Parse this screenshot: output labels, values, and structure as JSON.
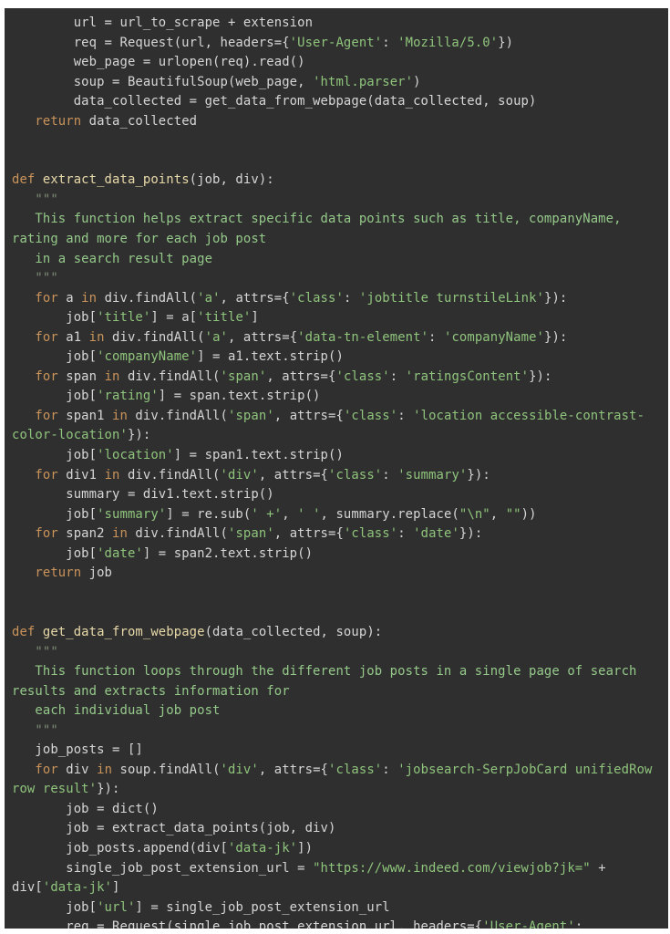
{
  "editor": {
    "language": "python",
    "lines": [
      [
        {
          "t": "        url = url_to_scrape + extension",
          "c": "pl"
        }
      ],
      [
        {
          "t": "        req = Request(url, headers={",
          "c": "pl"
        },
        {
          "t": "'User-Agent'",
          "c": "str"
        },
        {
          "t": ": ",
          "c": "pl"
        },
        {
          "t": "'Mozilla/5.0'",
          "c": "str"
        },
        {
          "t": "})",
          "c": "pl"
        }
      ],
      [
        {
          "t": "        web_page = urlopen(req).read()",
          "c": "pl"
        }
      ],
      [
        {
          "t": "        soup = BeautifulSoup(web_page, ",
          "c": "pl"
        },
        {
          "t": "'html.parser'",
          "c": "str"
        },
        {
          "t": ")",
          "c": "pl"
        }
      ],
      [
        {
          "t": "        data_collected = get_data_from_webpage(data_collected, soup)",
          "c": "pl"
        }
      ],
      [
        {
          "t": "   ",
          "c": "pl"
        },
        {
          "t": "return",
          "c": "kw"
        },
        {
          "t": " data_collected",
          "c": "pl"
        }
      ],
      [],
      [],
      [
        {
          "t": "def",
          "c": "kw"
        },
        {
          "t": " ",
          "c": "pl"
        },
        {
          "t": "extract_data_points",
          "c": "fn"
        },
        {
          "t": "(job, div):",
          "c": "pl"
        }
      ],
      [
        {
          "t": "   \"\"\"",
          "c": "dq"
        }
      ],
      [
        {
          "t": "   This function helps extract specific data points such as title, companyName,",
          "c": "doc"
        }
      ],
      [
        {
          "t": "rating and more for each job post",
          "c": "doc"
        }
      ],
      [
        {
          "t": "   in a search result page",
          "c": "doc"
        }
      ],
      [
        {
          "t": "   \"\"\"",
          "c": "dq"
        }
      ],
      [
        {
          "t": "   ",
          "c": "pl"
        },
        {
          "t": "for",
          "c": "kw"
        },
        {
          "t": " a ",
          "c": "pl"
        },
        {
          "t": "in",
          "c": "kw"
        },
        {
          "t": " div.findAll(",
          "c": "pl"
        },
        {
          "t": "'a'",
          "c": "str"
        },
        {
          "t": ", attrs={",
          "c": "pl"
        },
        {
          "t": "'class'",
          "c": "str"
        },
        {
          "t": ": ",
          "c": "pl"
        },
        {
          "t": "'jobtitle turnstileLink'",
          "c": "str"
        },
        {
          "t": "}):",
          "c": "pl"
        }
      ],
      [
        {
          "t": "       job[",
          "c": "pl"
        },
        {
          "t": "'title'",
          "c": "str"
        },
        {
          "t": "] = a[",
          "c": "pl"
        },
        {
          "t": "'title'",
          "c": "str"
        },
        {
          "t": "]",
          "c": "pl"
        }
      ],
      [
        {
          "t": "   ",
          "c": "pl"
        },
        {
          "t": "for",
          "c": "kw"
        },
        {
          "t": " a1 ",
          "c": "pl"
        },
        {
          "t": "in",
          "c": "kw"
        },
        {
          "t": " div.findAll(",
          "c": "pl"
        },
        {
          "t": "'a'",
          "c": "str"
        },
        {
          "t": ", attrs={",
          "c": "pl"
        },
        {
          "t": "'data-tn-element'",
          "c": "str"
        },
        {
          "t": ": ",
          "c": "pl"
        },
        {
          "t": "'companyName'",
          "c": "str"
        },
        {
          "t": "}):",
          "c": "pl"
        }
      ],
      [
        {
          "t": "       job[",
          "c": "pl"
        },
        {
          "t": "'companyName'",
          "c": "str"
        },
        {
          "t": "] = a1.text.strip()",
          "c": "pl"
        }
      ],
      [
        {
          "t": "   ",
          "c": "pl"
        },
        {
          "t": "for",
          "c": "kw"
        },
        {
          "t": " span ",
          "c": "pl"
        },
        {
          "t": "in",
          "c": "kw"
        },
        {
          "t": " div.findAll(",
          "c": "pl"
        },
        {
          "t": "'span'",
          "c": "str"
        },
        {
          "t": ", attrs={",
          "c": "pl"
        },
        {
          "t": "'class'",
          "c": "str"
        },
        {
          "t": ": ",
          "c": "pl"
        },
        {
          "t": "'ratingsContent'",
          "c": "str"
        },
        {
          "t": "}):",
          "c": "pl"
        }
      ],
      [
        {
          "t": "       job[",
          "c": "pl"
        },
        {
          "t": "'rating'",
          "c": "str"
        },
        {
          "t": "] = span.text.strip()",
          "c": "pl"
        }
      ],
      [
        {
          "t": "   ",
          "c": "pl"
        },
        {
          "t": "for",
          "c": "kw"
        },
        {
          "t": " span1 ",
          "c": "pl"
        },
        {
          "t": "in",
          "c": "kw"
        },
        {
          "t": " div.findAll(",
          "c": "pl"
        },
        {
          "t": "'span'",
          "c": "str"
        },
        {
          "t": ", attrs={",
          "c": "pl"
        },
        {
          "t": "'class'",
          "c": "str"
        },
        {
          "t": ": ",
          "c": "pl"
        },
        {
          "t": "'location accessible-contrast-",
          "c": "str"
        }
      ],
      [
        {
          "t": "color-location'",
          "c": "str"
        },
        {
          "t": "}):",
          "c": "pl"
        }
      ],
      [
        {
          "t": "       job[",
          "c": "pl"
        },
        {
          "t": "'location'",
          "c": "str"
        },
        {
          "t": "] = span1.text.strip()",
          "c": "pl"
        }
      ],
      [
        {
          "t": "   ",
          "c": "pl"
        },
        {
          "t": "for",
          "c": "kw"
        },
        {
          "t": " div1 ",
          "c": "pl"
        },
        {
          "t": "in",
          "c": "kw"
        },
        {
          "t": " div.findAll(",
          "c": "pl"
        },
        {
          "t": "'div'",
          "c": "str"
        },
        {
          "t": ", attrs={",
          "c": "pl"
        },
        {
          "t": "'class'",
          "c": "str"
        },
        {
          "t": ": ",
          "c": "pl"
        },
        {
          "t": "'summary'",
          "c": "str"
        },
        {
          "t": "}):",
          "c": "pl"
        }
      ],
      [
        {
          "t": "       summary = div1.text.strip()",
          "c": "pl"
        }
      ],
      [
        {
          "t": "       job[",
          "c": "pl"
        },
        {
          "t": "'summary'",
          "c": "str"
        },
        {
          "t": "] = re.sub(",
          "c": "pl"
        },
        {
          "t": "' +'",
          "c": "str"
        },
        {
          "t": ", ",
          "c": "pl"
        },
        {
          "t": "' '",
          "c": "str"
        },
        {
          "t": ", summary.replace(",
          "c": "pl"
        },
        {
          "t": "\"\\n\"",
          "c": "str"
        },
        {
          "t": ", ",
          "c": "pl"
        },
        {
          "t": "\"\"",
          "c": "str"
        },
        {
          "t": "))",
          "c": "pl"
        }
      ],
      [
        {
          "t": "   ",
          "c": "pl"
        },
        {
          "t": "for",
          "c": "kw"
        },
        {
          "t": " span2 ",
          "c": "pl"
        },
        {
          "t": "in",
          "c": "kw"
        },
        {
          "t": " div.findAll(",
          "c": "pl"
        },
        {
          "t": "'span'",
          "c": "str"
        },
        {
          "t": ", attrs={",
          "c": "pl"
        },
        {
          "t": "'class'",
          "c": "str"
        },
        {
          "t": ": ",
          "c": "pl"
        },
        {
          "t": "'date'",
          "c": "str"
        },
        {
          "t": "}):",
          "c": "pl"
        }
      ],
      [
        {
          "t": "       job[",
          "c": "pl"
        },
        {
          "t": "'date'",
          "c": "str"
        },
        {
          "t": "] = span2.text.strip()",
          "c": "pl"
        }
      ],
      [
        {
          "t": "   ",
          "c": "pl"
        },
        {
          "t": "return",
          "c": "kw"
        },
        {
          "t": " job",
          "c": "pl"
        }
      ],
      [],
      [],
      [
        {
          "t": "def",
          "c": "kw"
        },
        {
          "t": " ",
          "c": "pl"
        },
        {
          "t": "get_data_from_webpage",
          "c": "fn"
        },
        {
          "t": "(data_collected, soup):",
          "c": "pl"
        }
      ],
      [
        {
          "t": "   \"\"\"",
          "c": "dq"
        }
      ],
      [
        {
          "t": "   This function loops through the different job posts in a single page of search",
          "c": "doc"
        }
      ],
      [
        {
          "t": "results and extracts information for",
          "c": "doc"
        }
      ],
      [
        {
          "t": "   each individual job post",
          "c": "doc"
        }
      ],
      [
        {
          "t": "   \"\"\"",
          "c": "dq"
        }
      ],
      [
        {
          "t": "   job_posts = []",
          "c": "pl"
        }
      ],
      [
        {
          "t": "   ",
          "c": "pl"
        },
        {
          "t": "for",
          "c": "kw"
        },
        {
          "t": " div ",
          "c": "pl"
        },
        {
          "t": "in",
          "c": "kw"
        },
        {
          "t": " soup.findAll(",
          "c": "pl"
        },
        {
          "t": "'div'",
          "c": "str"
        },
        {
          "t": ", attrs={",
          "c": "pl"
        },
        {
          "t": "'class'",
          "c": "str"
        },
        {
          "t": ": ",
          "c": "pl"
        },
        {
          "t": "'jobsearch-SerpJobCard unifiedRow",
          "c": "str"
        }
      ],
      [
        {
          "t": "row result'",
          "c": "str"
        },
        {
          "t": "}):",
          "c": "pl"
        }
      ],
      [
        {
          "t": "       job = dict()",
          "c": "pl"
        }
      ],
      [
        {
          "t": "       job = extract_data_points(job, div)",
          "c": "pl"
        }
      ],
      [
        {
          "t": "       job_posts.append(div[",
          "c": "pl"
        },
        {
          "t": "'data-jk'",
          "c": "str"
        },
        {
          "t": "])",
          "c": "pl"
        }
      ],
      [
        {
          "t": "       single_job_post_extension_url = ",
          "c": "pl"
        },
        {
          "t": "\"https://www.indeed.com/viewjob?jk=\"",
          "c": "str"
        },
        {
          "t": " +",
          "c": "pl"
        }
      ],
      [
        {
          "t": "div[",
          "c": "pl"
        },
        {
          "t": "'data-jk'",
          "c": "str"
        },
        {
          "t": "]",
          "c": "pl"
        }
      ],
      [
        {
          "t": "       job[",
          "c": "pl"
        },
        {
          "t": "'url'",
          "c": "str"
        },
        {
          "t": "] = single_job_post_extension_url",
          "c": "pl"
        }
      ],
      [
        {
          "t": "       req = Request(single_job_post_extension_url, headers={",
          "c": "pl"
        },
        {
          "t": "'User-Agent'",
          "c": "str"
        },
        {
          "t": ":",
          "c": "pl"
        }
      ]
    ]
  },
  "colors": {
    "background": "#2f2f2f",
    "keyword": "#c9935a",
    "function_name": "#e8d9a8",
    "string": "#8fc47c",
    "docstring": "#95c98a",
    "plain": "#d6d6d6"
  }
}
